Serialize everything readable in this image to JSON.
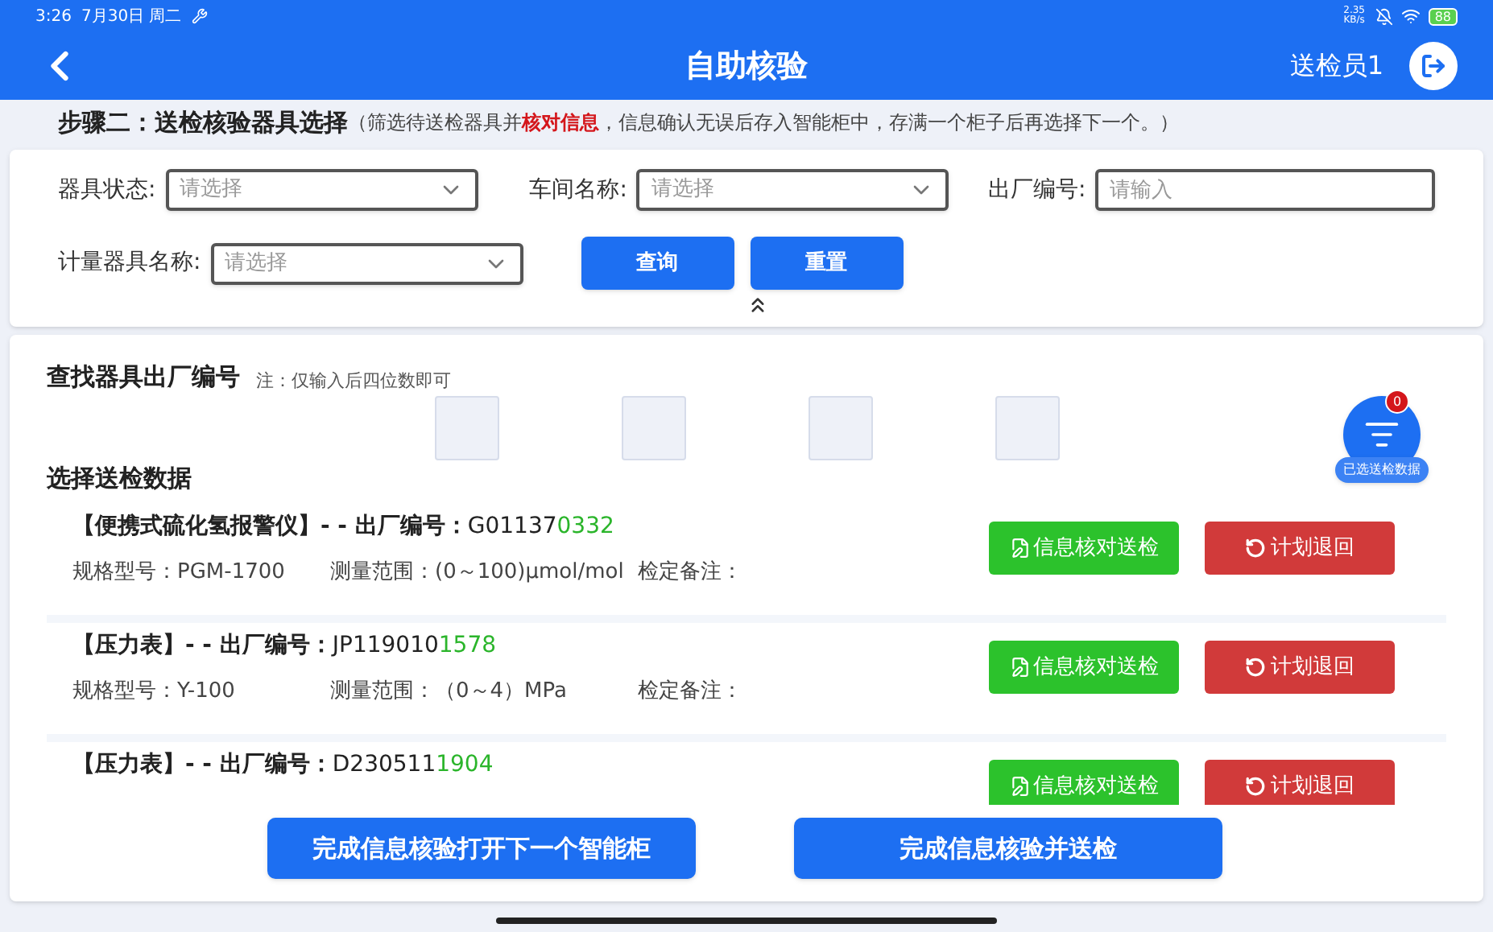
{
  "status_bar": {
    "time": "3:26",
    "date": "7月30日 周二",
    "net_speed": "2.35 KB/s",
    "battery": "88"
  },
  "header": {
    "title": "自助核验",
    "user": "送检员1"
  },
  "step": {
    "title": "步骤二：送检核验器具选择",
    "note": "（筛选待送检器具并**核对信息**，信息确认无误后存入智能柜中，存满一个柜子后再选择下一个。）"
  },
  "filters": [
    {
      "kind": "select",
      "label": "器具状态:",
      "placeholder": "请选择"
    },
    {
      "kind": "select",
      "label": "车间名称:",
      "placeholder": "请选择"
    },
    {
      "kind": "input",
      "label": "出厂编号:",
      "placeholder": "请输入"
    },
    {
      "kind": "select",
      "label": "计量器具名称:",
      "placeholder": "请选择"
    }
  ],
  "filter_buttons": [
    "查询",
    "重置"
  ],
  "search": {
    "title": "查找器具出厂编号",
    "note": "注：仅输入后四位数即可"
  },
  "selected_fab": {
    "label": "已选送检数据",
    "count": "0"
  },
  "list_title": "选择送检数据",
  "rows": [
    {
      "name": "【便携式硫化氢报警仪】- - 出厂编号：",
      "serial_prefix": "G01137",
      "serial_highlight": "0332",
      "spec": "规格型号：PGM-1700",
      "range": "测量范围：(0～100)μmol/mol",
      "note": "检定备注：",
      "verify": "信息核对送检",
      "return": "计划退回"
    },
    {
      "name": "【压力表】- - 出厂编号：",
      "serial_prefix": "JP119010",
      "serial_highlight": "1578",
      "spec": "规格型号：Y-100",
      "range": "测量范围：（0～4）MPa",
      "note": "检定备注：",
      "verify": "信息核对送检",
      "return": "计划退回"
    },
    {
      "name": "【压力表】- - 出厂编号：",
      "serial_prefix": "D230511",
      "serial_highlight": "1904",
      "verify": "信息核对送检",
      "return": "计划退回"
    }
  ],
  "bottom_buttons": [
    "完成信息核验打开下一个智能柜",
    "完成信息核验并送检"
  ]
}
